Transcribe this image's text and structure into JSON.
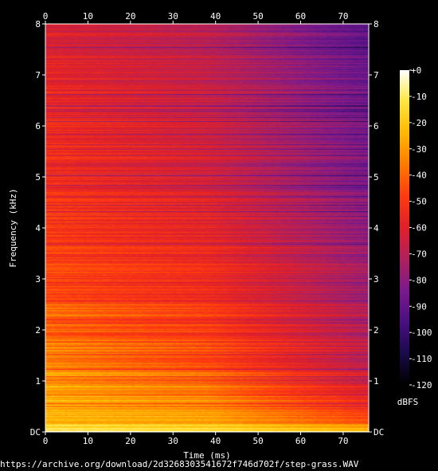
{
  "chart_data": {
    "type": "heatmap",
    "title": "",
    "xlabel": "Time (ms)",
    "ylabel": "Frequency (kHz)",
    "x_ticks": [
      "0",
      "10",
      "20",
      "30",
      "40",
      "50",
      "60",
      "70"
    ],
    "x_tick_values": [
      0,
      10,
      20,
      30,
      40,
      50,
      60,
      70
    ],
    "xlim": [
      0,
      76
    ],
    "y_ticks": [
      "DC",
      "1",
      "2",
      "3",
      "4",
      "5",
      "6",
      "7",
      "8"
    ],
    "y_tick_values": [
      0,
      1,
      2,
      3,
      4,
      5,
      6,
      7,
      8
    ],
    "ylim": [
      0,
      8
    ],
    "colorbar": {
      "label": "dBFS",
      "ticks": [
        "+0",
        "-10",
        "-20",
        "-30",
        "-40",
        "-50",
        "-60",
        "-70",
        "-80",
        "-90",
        "-100",
        "-110",
        "-120"
      ],
      "tick_values": [
        0,
        -10,
        -20,
        -30,
        -40,
        -50,
        -60,
        -70,
        -80,
        -90,
        -100,
        -110,
        -120
      ],
      "range": [
        -120,
        0
      ],
      "colors": [
        "#000000",
        "#1a0a4a",
        "#4a0f80",
        "#7a1a8c",
        "#b0205c",
        "#e0202a",
        "#ff3a10",
        "#ff7a00",
        "#ffb800",
        "#ffe640",
        "#ffffff"
      ]
    },
    "energy_profile_dbfs": {
      "freq_khz": [
        0.0,
        0.05,
        0.3,
        0.6,
        1.0,
        1.4,
        1.7,
        2.0,
        2.4,
        2.5,
        3.0,
        4.0,
        5.0,
        6.0,
        7.0,
        8.0
      ],
      "at_0ms": [
        -5,
        -15,
        -22,
        -25,
        -28,
        -32,
        -36,
        -42,
        -38,
        -43,
        -47,
        -49,
        -51,
        -54,
        -58,
        -62
      ],
      "at_38ms": [
        -8,
        -18,
        -26,
        -32,
        -38,
        -44,
        -47,
        -50,
        -49,
        -52,
        -55,
        -58,
        -61,
        -64,
        -67,
        -70
      ],
      "at_76ms": [
        -15,
        -28,
        -45,
        -55,
        -63,
        -68,
        -70,
        -73,
        -72,
        -75,
        -77,
        -80,
        -82,
        -85,
        -88,
        -92
      ]
    }
  },
  "source_url": "https://archive.org/download/2d3268303541672f746d702f/step-grass.WAV"
}
